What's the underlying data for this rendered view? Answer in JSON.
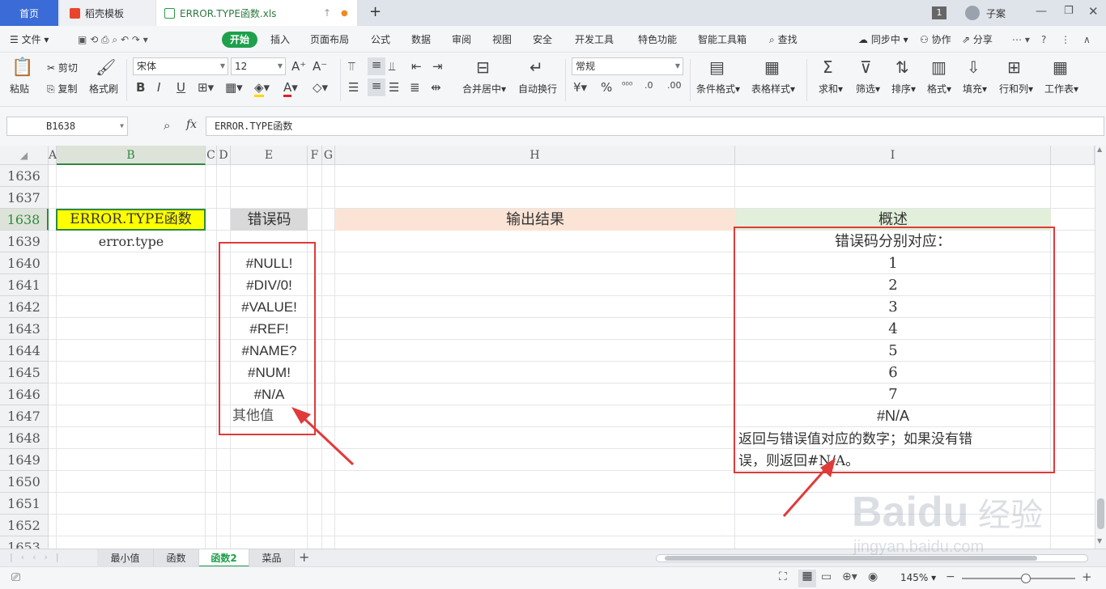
{
  "titlebar": {
    "tab_home": "首页",
    "tab_template": "稻壳模板",
    "tab_file": "ERROR.TYPE函数.xls",
    "new_tab": "+",
    "badge": "1",
    "user": "子案"
  },
  "menu": {
    "file": "文件",
    "start": "开始",
    "items": [
      "插入",
      "页面布局",
      "公式",
      "数据",
      "审阅",
      "视图",
      "安全",
      "开发工具",
      "特色功能",
      "智能工具箱"
    ],
    "search": "查找",
    "sync": "同步中",
    "collab": "协作",
    "share": "分享"
  },
  "ribbon": {
    "paste": "粘贴",
    "cut": "剪切",
    "copy": "复制",
    "format_painter": "格式刷",
    "font_name": "宋体",
    "font_size": "12",
    "merge_center": "合并居中",
    "wrap_text": "自动换行",
    "number_format": "常规",
    "cond_format": "条件格式",
    "table_style": "表格样式",
    "sum": "求和",
    "filter": "筛选",
    "sort": "排序",
    "format": "格式",
    "fill": "填充",
    "row_col": "行和列",
    "worksheet": "工作表"
  },
  "formula_bar": {
    "cell_ref": "B1638",
    "fx": "fx",
    "content": "ERROR.TYPE函数"
  },
  "columns": [
    "A",
    "B",
    "C",
    "D",
    "E",
    "F",
    "G",
    "H",
    "I"
  ],
  "rows": [
    "1636",
    "1637",
    "1638",
    "1639",
    "1640",
    "1641",
    "1642",
    "1643",
    "1644",
    "1645",
    "1646",
    "1647",
    "1648",
    "1649",
    "1650",
    "1651",
    "1652",
    "1653"
  ],
  "cells": {
    "b1638": "ERROR.TYPE函数",
    "b1639": "error.type",
    "e1638": "错误码",
    "h1638": "输出结果",
    "i1638": "概述",
    "e_codes": [
      "#NULL!",
      "#DIV/0!",
      "#VALUE!",
      "#REF!",
      "#NAME?",
      "#NUM!",
      "#N/A",
      "其他值"
    ],
    "i1639": "错误码分别对应：",
    "i_values": [
      "1",
      "2",
      "3",
      "4",
      "5",
      "6",
      "7",
      "#N/A"
    ],
    "i1648": "返回与错误值对应的数字；如果没有错",
    "i1649": "误，则返回#N/A。"
  },
  "sheets": [
    "最小值",
    "函数",
    "函数2",
    "菜品"
  ],
  "status": {
    "zoom": "145%"
  },
  "colors": {
    "accent_green": "#1fa04c",
    "highlight_yellow": "#ffff00",
    "header_pink": "#fbe4d6",
    "header_green": "#e2efda",
    "header_gray": "#d9d9d9",
    "annotation_red": "#e03a3a"
  }
}
